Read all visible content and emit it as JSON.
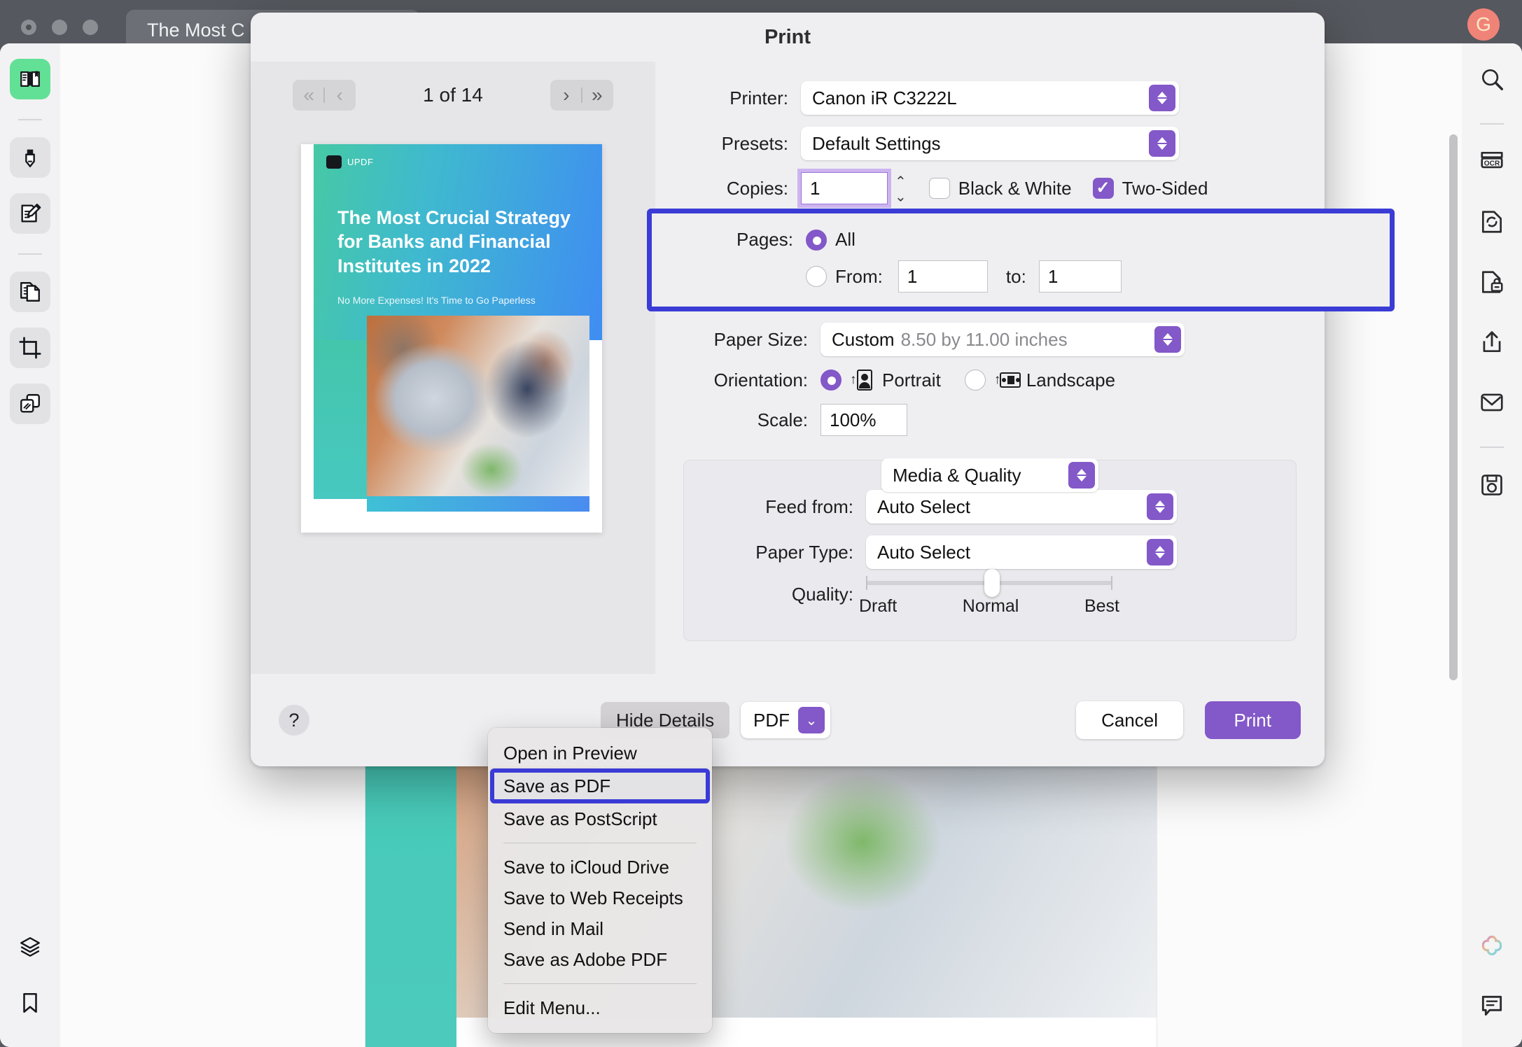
{
  "window": {
    "doc_tab_title": "The Most C",
    "avatar_initial": "G"
  },
  "left_sidebar": {
    "items": [
      {
        "name": "reader-tool",
        "icon": "book-reader-icon",
        "active": true
      },
      {
        "name": "highlight-tool",
        "icon": "highlighter-icon",
        "active": false
      },
      {
        "name": "edit-tool",
        "icon": "edit-document-icon",
        "active": false
      },
      {
        "name": "organize-pages-tool",
        "icon": "pages-icon",
        "active": false
      },
      {
        "name": "crop-tool",
        "icon": "crop-icon",
        "active": false
      },
      {
        "name": "batch-tool",
        "icon": "batch-process-icon",
        "active": false
      },
      {
        "name": "layers-tool",
        "icon": "layers-icon",
        "active": false
      },
      {
        "name": "bookmark-tool",
        "icon": "bookmark-icon",
        "active": false
      }
    ]
  },
  "right_sidebar": {
    "items": [
      {
        "name": "search-tool",
        "icon": "search-icon"
      },
      {
        "name": "ocr-tool",
        "icon": "ocr-icon"
      },
      {
        "name": "convert-tool",
        "icon": "convert-icon"
      },
      {
        "name": "protect-tool",
        "icon": "lock-document-icon"
      },
      {
        "name": "share-tool",
        "icon": "share-icon"
      },
      {
        "name": "mail-tool",
        "icon": "envelope-icon"
      },
      {
        "name": "save-tool",
        "icon": "save-icon"
      },
      {
        "name": "ai-tool",
        "icon": "ai-clover-icon"
      },
      {
        "name": "comment-tool",
        "icon": "comment-icon"
      }
    ]
  },
  "print_dialog": {
    "title": "Print",
    "preview": {
      "page_label": "1 of 14",
      "first_page_icon": "double-chevron-left-icon",
      "prev_page_icon": "chevron-left-icon",
      "next_page_icon": "chevron-right-icon",
      "last_page_icon": "double-chevron-right-icon",
      "thumbnail": {
        "logo": "UPDF",
        "heading": "The Most Crucial Strategy for Banks and Financial Institutes in 2022",
        "subheading": "No More Expenses! It's Time to Go Paperless"
      }
    },
    "settings": {
      "printer_label": "Printer:",
      "printer_value": "Canon iR C3222L",
      "presets_label": "Presets:",
      "presets_value": "Default Settings",
      "copies_label": "Copies:",
      "copies_value": "1",
      "black_white_label": "Black & White",
      "black_white_checked": false,
      "two_sided_label": "Two-Sided",
      "two_sided_checked": true,
      "pages_label": "Pages:",
      "pages_all_label": "All",
      "pages_all_selected": true,
      "pages_from_label": "From:",
      "pages_from_value": "1",
      "pages_to_label": "to:",
      "pages_to_value": "1",
      "paper_size_label": "Paper Size:",
      "paper_size_value": "Custom",
      "paper_size_detail": "8.50 by 11.00 inches",
      "orientation_label": "Orientation:",
      "orientation_portrait_label": "Portrait",
      "orientation_portrait_selected": true,
      "orientation_landscape_label": "Landscape",
      "scale_label": "Scale:",
      "scale_value": "100%",
      "module_value": "Media & Quality",
      "feed_from_label": "Feed from:",
      "feed_from_value": "Auto Select",
      "paper_type_label": "Paper Type:",
      "paper_type_value": "Auto Select",
      "quality_label": "Quality:",
      "quality_draft_label": "Draft",
      "quality_normal_label": "Normal",
      "quality_best_label": "Best",
      "quality_position_percent": 48
    },
    "footer": {
      "help_label": "?",
      "hide_details_label": "Hide Details",
      "pdf_label": "PDF",
      "pdf_chevron_icon": "chevron-down-icon",
      "cancel_label": "Cancel",
      "print_label": "Print"
    },
    "pdf_menu": {
      "items": [
        {
          "label": "Open in Preview",
          "selected": false,
          "separator_after": false
        },
        {
          "label": "Save as PDF",
          "selected": true,
          "separator_after": false
        },
        {
          "label": "Save as PostScript",
          "selected": false,
          "separator_after": true
        },
        {
          "label": "Save to iCloud Drive",
          "selected": false,
          "separator_after": false
        },
        {
          "label": "Save to Web Receipts",
          "selected": false,
          "separator_after": false
        },
        {
          "label": "Send in Mail",
          "selected": false,
          "separator_after": false
        },
        {
          "label": "Save as Adobe PDF",
          "selected": false,
          "separator_after": true
        },
        {
          "label": "Edit Menu...",
          "selected": false,
          "separator_after": false
        }
      ]
    }
  },
  "colors": {
    "accent_purple": "#8358c8",
    "annotation_blue": "#3b3bd6",
    "active_green": "#62e096",
    "avatar": "#f08377"
  }
}
